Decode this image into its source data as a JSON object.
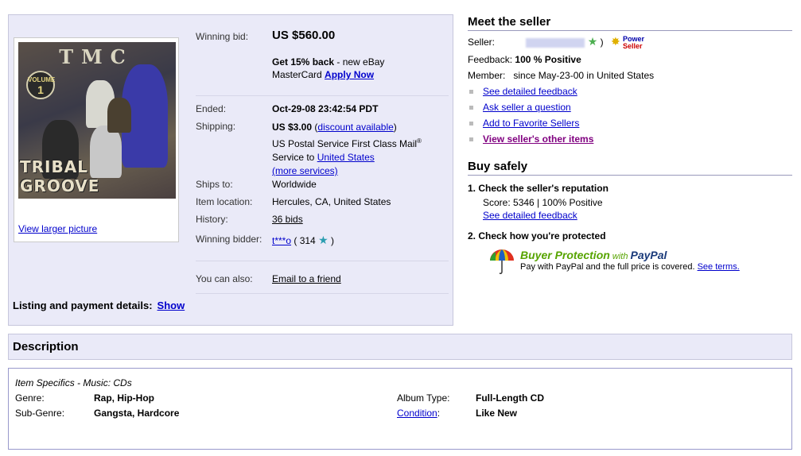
{
  "item": {
    "view_larger_label": "View larger picture",
    "winning_bid_label": "Winning bid:",
    "winning_bid_value": "US $560.00",
    "promo_bold": "Get 15% back",
    "promo_text": " - new eBay MasterCard ",
    "promo_link": "Apply Now",
    "ended_label": "Ended:",
    "ended_value": "Oct-29-08 23:42:54 PDT",
    "shipping_label": "Shipping:",
    "shipping_value": "US $3.00",
    "shipping_discount_link": "discount available",
    "shipping_service_1": "US Postal Service First Class Mail",
    "shipping_service_sup": "®",
    "shipping_service_2": "Service to ",
    "shipping_country_link": "United States",
    "more_services_link": "(more services)",
    "ships_to_label": "Ships to:",
    "ships_to_value": "Worldwide",
    "location_label": "Item location:",
    "location_value": "Hercules, CA, United States",
    "history_label": "History:",
    "history_link": "36 bids",
    "winning_bidder_label": "Winning bidder:",
    "winning_bidder_link": "t***o",
    "winning_bidder_score": " ( 314 ",
    "winning_bidder_close": " )",
    "you_can_also_label": "You can also:",
    "email_friend_link": "Email to a friend",
    "listing_details_label": "Listing and payment details:",
    "listing_details_link": "Show",
    "album_art": {
      "logo": "TMC",
      "volume_line1": "VOLUME",
      "volume_line2": "1",
      "title": "TRIBAL GROOVE"
    }
  },
  "seller": {
    "heading": "Meet the seller",
    "seller_label": "Seller:",
    "seller_close_paren": ")",
    "power_seller_1": "Power",
    "power_seller_2": "Seller",
    "feedback_label": "Feedback:",
    "feedback_value": "100 % Positive",
    "member_label": "Member:",
    "member_value": "since May-23-00 in United States",
    "links": [
      "See detailed feedback",
      "Ask seller a question",
      "Add to Favorite Sellers",
      "View seller's other items"
    ]
  },
  "buy_safely": {
    "heading": "Buy safely",
    "step1": "1.  Check the seller's reputation",
    "score_text": "Score: 5346 | 100% Positive",
    "detailed_feedback_link": "See detailed feedback",
    "step2": "2.  Check how you're protected",
    "bp_main": "Buyer Protection",
    "bp_with": " with ",
    "bp_paypal": "PayPal",
    "bp_text": "Pay with PayPal and the full price is covered. ",
    "see_terms_link": "See terms."
  },
  "description": {
    "heading": "Description",
    "specifics_title": "Item Specifics - Music: CDs",
    "genre_label": "Genre:",
    "genre_value": "Rap, Hip-Hop",
    "subgenre_label": "Sub-Genre:",
    "subgenre_value": "Gangsta, Hardcore",
    "album_type_label": "Album Type:",
    "album_type_value": "Full-Length CD",
    "condition_link": "Condition",
    "condition_colon": ":",
    "condition_value": "Like New"
  },
  "colors": {
    "panel_bg": "#eaeaf8",
    "link": "#0000cc",
    "visited_link": "#800080",
    "buyer_protection_green": "#57a400"
  }
}
